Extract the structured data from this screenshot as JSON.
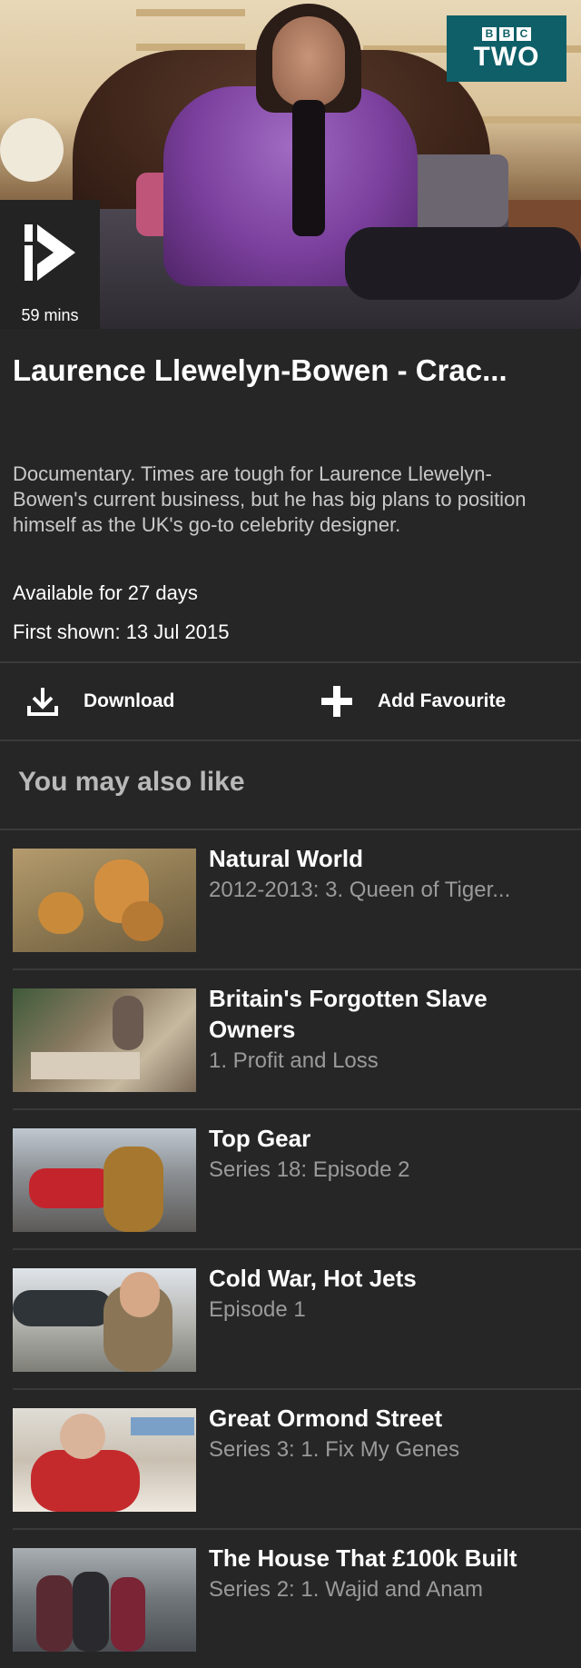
{
  "hero": {
    "channel_top": [
      "B",
      "B",
      "C"
    ],
    "channel_name": "TWO",
    "duration": "59 mins",
    "play_icon": "iplayer-play-icon"
  },
  "programme": {
    "title": "Laurence Llewelyn-Bowen - Crac...",
    "description": "Documentary. Times are tough for Laurence Llewelyn-Bowen's current business, but he has big plans to position himself as the UK's go-to celebrity designer.",
    "availability": "Available for 27 days",
    "first_shown": "First shown: 13 Jul 2015"
  },
  "actions": {
    "download_label": "Download",
    "download_icon": "download-icon",
    "favourite_label": "Add Favourite",
    "favourite_icon": "plus-icon"
  },
  "recommendations": {
    "heading": "You may also like",
    "items": [
      {
        "title": "Natural World",
        "subtitle": "2012-2013: 3. Queen of Tiger..."
      },
      {
        "title": "Britain's Forgotten Slave Owners",
        "subtitle": "1. Profit and Loss"
      },
      {
        "title": "Top Gear",
        "subtitle": "Series 18: Episode 2"
      },
      {
        "title": "Cold War, Hot Jets",
        "subtitle": "Episode 1"
      },
      {
        "title": "Great Ormond Street",
        "subtitle": "Series 3: 1. Fix My Genes"
      },
      {
        "title": "The House That £100k Built",
        "subtitle": "Series 2: 1. Wajid and Anam"
      }
    ]
  },
  "colors": {
    "background": "#262626",
    "channel_badge": "#0e5f67",
    "divider": "#3a3a3a",
    "muted_text": "#9a9a9a"
  }
}
